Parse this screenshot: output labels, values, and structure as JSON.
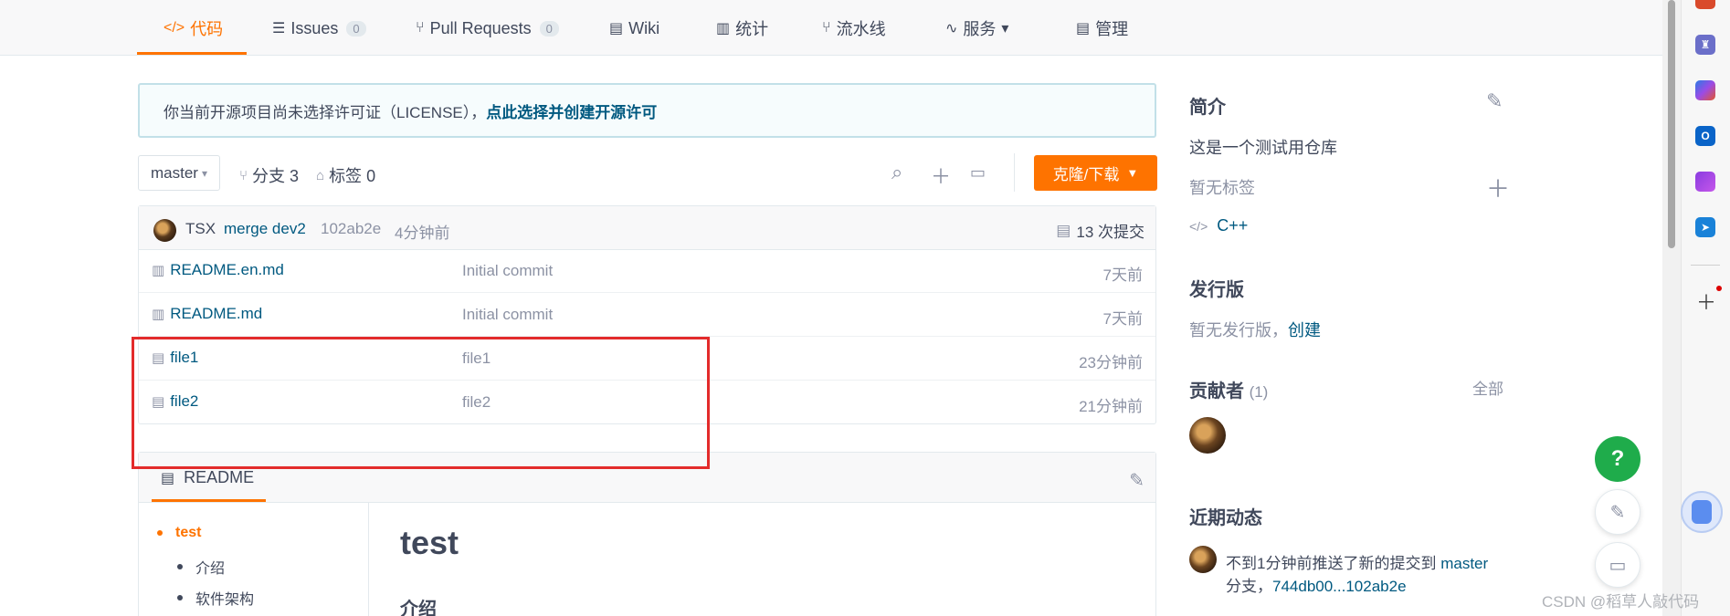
{
  "nav": {
    "tabs": [
      {
        "icon": "</>",
        "label": "代码"
      },
      {
        "icon": "☰",
        "label": "Issues",
        "count": "0"
      },
      {
        "icon": "⑂",
        "label": "Pull Requests",
        "count": "0"
      },
      {
        "icon": "▤",
        "label": "Wiki"
      },
      {
        "icon": "▥",
        "label": "统计"
      },
      {
        "icon": "⑂",
        "label": "流水线"
      },
      {
        "icon": "∿",
        "label": "服务"
      },
      {
        "icon": "▤",
        "label": "管理"
      }
    ],
    "accent_color": "#fe7300"
  },
  "notice": {
    "text": "你当前开源项目尚未选择许可证（LICENSE），",
    "link": "点此选择并创建开源许可"
  },
  "branch": {
    "current": "master",
    "branches_label": "分支 3",
    "tags_label": "标签 0",
    "clone_label": "克隆/下载"
  },
  "commit": {
    "author": "TSX",
    "message": "merge dev2",
    "sha": "102ab2e",
    "time": "4分钟前",
    "commits_label": "13 次提交"
  },
  "files": [
    {
      "name": "README.en.md",
      "message": "Initial commit",
      "time": "7天前",
      "icon": "book-icon"
    },
    {
      "name": "README.md",
      "message": "Initial commit",
      "time": "7天前",
      "icon": "book-icon"
    },
    {
      "name": "file1",
      "message": "file1",
      "time": "23分钟前",
      "icon": "file-icon"
    },
    {
      "name": "file2",
      "message": "file2",
      "time": "21分钟前",
      "icon": "file-icon"
    }
  ],
  "readme": {
    "title": "README",
    "toc": [
      "test",
      "介绍",
      "软件架构"
    ],
    "h1": "test",
    "h2": "介绍"
  },
  "sidebar": {
    "intro_title": "简介",
    "description": "这是一个测试用仓库",
    "no_tags": "暂无标签",
    "language": "C++",
    "releases_title": "发行版",
    "no_releases": "暂无发行版，",
    "create_link": "创建",
    "contributors_title": "贡献者",
    "contributors_count": "(1)",
    "all_link": "全部",
    "activity_title": "近期动态",
    "activity_text": "不到1分钟前推送了新的提交到",
    "activity_branch": "master",
    "activity_text2": "分支，",
    "activity_range": "744db00...102ab2e"
  },
  "fab": {
    "help": "?"
  },
  "watermark": "CSDN @稻草人敲代码"
}
